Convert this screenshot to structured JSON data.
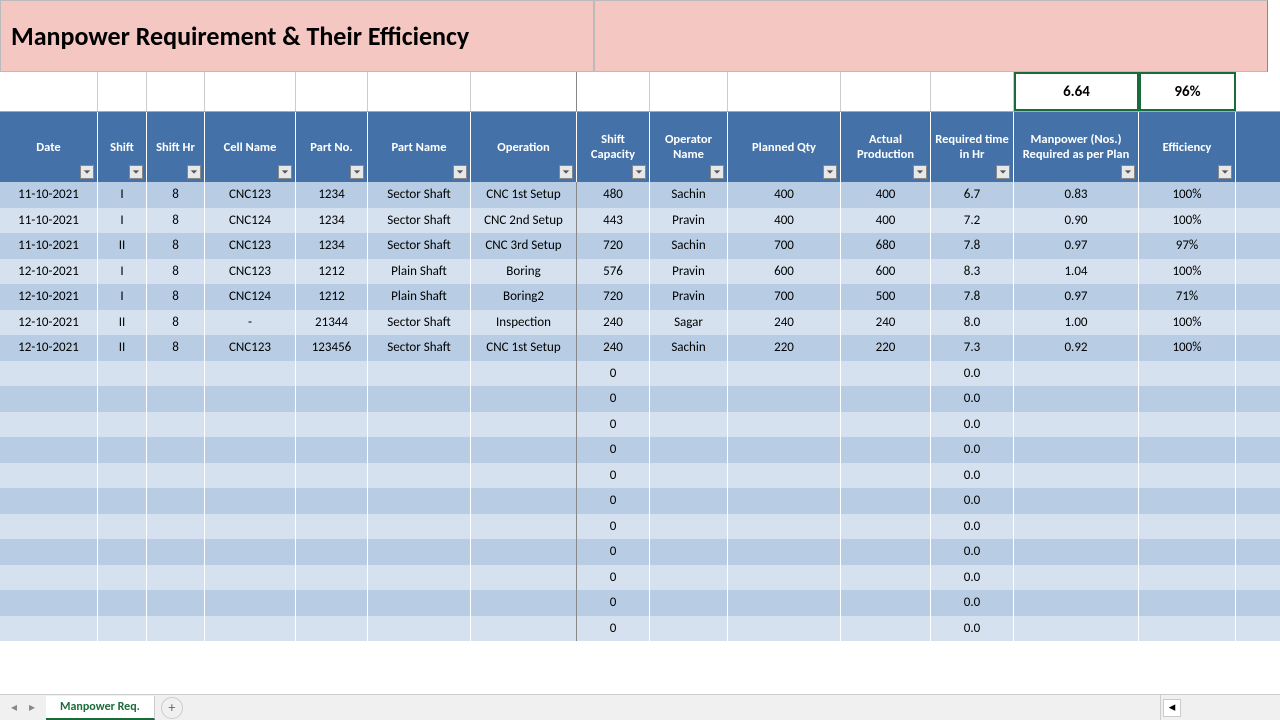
{
  "title": "Manpower Requirement & Their Efficiency",
  "summary": {
    "manpower_total": "6.64",
    "efficiency_total": "96%"
  },
  "headers": [
    "Date",
    "Shift",
    "Shift Hr",
    "Cell Name",
    "Part No.",
    "Part Name",
    "Operation",
    "Shift Capacity",
    "Operator Name",
    "Planned Qty",
    "Actual Production",
    "Required time in Hr",
    "Manpower (Nos.) Required as per Plan",
    "Efficiency"
  ],
  "rows": [
    {
      "date": "11-10-2021",
      "shift": "I",
      "shifthr": "8",
      "cellname": "CNC123",
      "partno": "1234",
      "partname": "Sector Shaft",
      "operation": "CNC 1st Setup",
      "shiftcap": "480",
      "opname": "Sachin",
      "planqty": "400",
      "actprod": "400",
      "reqtime": "6.7",
      "manpower": "0.83",
      "eff": "100%"
    },
    {
      "date": "11-10-2021",
      "shift": "I",
      "shifthr": "8",
      "cellname": "CNC124",
      "partno": "1234",
      "partname": "Sector Shaft",
      "operation": "CNC 2nd Setup",
      "shiftcap": "443",
      "opname": "Pravin",
      "planqty": "400",
      "actprod": "400",
      "reqtime": "7.2",
      "manpower": "0.90",
      "eff": "100%"
    },
    {
      "date": "11-10-2021",
      "shift": "II",
      "shifthr": "8",
      "cellname": "CNC123",
      "partno": "1234",
      "partname": "Sector Shaft",
      "operation": "CNC 3rd Setup",
      "shiftcap": "720",
      "opname": "Sachin",
      "planqty": "700",
      "actprod": "680",
      "reqtime": "7.8",
      "manpower": "0.97",
      "eff": "97%"
    },
    {
      "date": "12-10-2021",
      "shift": "I",
      "shifthr": "8",
      "cellname": "CNC123",
      "partno": "1212",
      "partname": "Plain Shaft",
      "operation": "Boring",
      "shiftcap": "576",
      "opname": "Pravin",
      "planqty": "600",
      "actprod": "600",
      "reqtime": "8.3",
      "manpower": "1.04",
      "eff": "100%"
    },
    {
      "date": "12-10-2021",
      "shift": "I",
      "shifthr": "8",
      "cellname": "CNC124",
      "partno": "1212",
      "partname": "Plain Shaft",
      "operation": "Boring2",
      "shiftcap": "720",
      "opname": "Pravin",
      "planqty": "700",
      "actprod": "500",
      "reqtime": "7.8",
      "manpower": "0.97",
      "eff": "71%"
    },
    {
      "date": "12-10-2021",
      "shift": "II",
      "shifthr": "8",
      "cellname": "-",
      "partno": "21344",
      "partname": "Sector Shaft",
      "operation": "Inspection",
      "shiftcap": "240",
      "opname": "Sagar",
      "planqty": "240",
      "actprod": "240",
      "reqtime": "8.0",
      "manpower": "1.00",
      "eff": "100%"
    },
    {
      "date": "12-10-2021",
      "shift": "II",
      "shifthr": "8",
      "cellname": "CNC123",
      "partno": "123456",
      "partname": "Sector Shaft",
      "operation": "CNC 1st Setup",
      "shiftcap": "240",
      "opname": "Sachin",
      "planqty": "220",
      "actprod": "220",
      "reqtime": "7.3",
      "manpower": "0.92",
      "eff": "100%"
    },
    {
      "date": "",
      "shift": "",
      "shifthr": "",
      "cellname": "",
      "partno": "",
      "partname": "",
      "operation": "",
      "shiftcap": "0",
      "opname": "",
      "planqty": "",
      "actprod": "",
      "reqtime": "0.0",
      "manpower": "",
      "eff": ""
    },
    {
      "date": "",
      "shift": "",
      "shifthr": "",
      "cellname": "",
      "partno": "",
      "partname": "",
      "operation": "",
      "shiftcap": "0",
      "opname": "",
      "planqty": "",
      "actprod": "",
      "reqtime": "0.0",
      "manpower": "",
      "eff": ""
    },
    {
      "date": "",
      "shift": "",
      "shifthr": "",
      "cellname": "",
      "partno": "",
      "partname": "",
      "operation": "",
      "shiftcap": "0",
      "opname": "",
      "planqty": "",
      "actprod": "",
      "reqtime": "0.0",
      "manpower": "",
      "eff": ""
    },
    {
      "date": "",
      "shift": "",
      "shifthr": "",
      "cellname": "",
      "partno": "",
      "partname": "",
      "operation": "",
      "shiftcap": "0",
      "opname": "",
      "planqty": "",
      "actprod": "",
      "reqtime": "0.0",
      "manpower": "",
      "eff": ""
    },
    {
      "date": "",
      "shift": "",
      "shifthr": "",
      "cellname": "",
      "partno": "",
      "partname": "",
      "operation": "",
      "shiftcap": "0",
      "opname": "",
      "planqty": "",
      "actprod": "",
      "reqtime": "0.0",
      "manpower": "",
      "eff": ""
    },
    {
      "date": "",
      "shift": "",
      "shifthr": "",
      "cellname": "",
      "partno": "",
      "partname": "",
      "operation": "",
      "shiftcap": "0",
      "opname": "",
      "planqty": "",
      "actprod": "",
      "reqtime": "0.0",
      "manpower": "",
      "eff": ""
    },
    {
      "date": "",
      "shift": "",
      "shifthr": "",
      "cellname": "",
      "partno": "",
      "partname": "",
      "operation": "",
      "shiftcap": "0",
      "opname": "",
      "planqty": "",
      "actprod": "",
      "reqtime": "0.0",
      "manpower": "",
      "eff": ""
    },
    {
      "date": "",
      "shift": "",
      "shifthr": "",
      "cellname": "",
      "partno": "",
      "partname": "",
      "operation": "",
      "shiftcap": "0",
      "opname": "",
      "planqty": "",
      "actprod": "",
      "reqtime": "0.0",
      "manpower": "",
      "eff": ""
    },
    {
      "date": "",
      "shift": "",
      "shifthr": "",
      "cellname": "",
      "partno": "",
      "partname": "",
      "operation": "",
      "shiftcap": "0",
      "opname": "",
      "planqty": "",
      "actprod": "",
      "reqtime": "0.0",
      "manpower": "",
      "eff": ""
    },
    {
      "date": "",
      "shift": "",
      "shifthr": "",
      "cellname": "",
      "partno": "",
      "partname": "",
      "operation": "",
      "shiftcap": "0",
      "opname": "",
      "planqty": "",
      "actprod": "",
      "reqtime": "0.0",
      "manpower": "",
      "eff": ""
    },
    {
      "date": "",
      "shift": "",
      "shifthr": "",
      "cellname": "",
      "partno": "",
      "partname": "",
      "operation": "",
      "shiftcap": "0",
      "opname": "",
      "planqty": "",
      "actprod": "",
      "reqtime": "0.0",
      "manpower": "",
      "eff": ""
    }
  ],
  "tabs": {
    "active": "Manpower Req."
  }
}
